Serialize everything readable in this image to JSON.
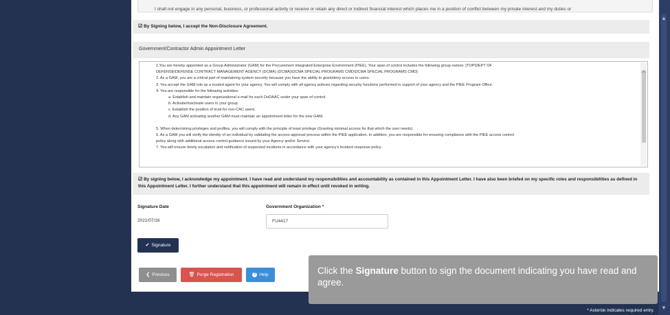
{
  "nda": {
    "last_line": "I shall not engage in any personal, business, or professional activity or receive or retain any direct or indirect financial interest which places me in a position of conflict between my private interest and my duties or",
    "accept_icon": "check-square-icon",
    "accept_text": "By Signing below, I accept the Non-Disclosure Agreement."
  },
  "letter": {
    "heading": "Government/Contractor Admin Appointment Letter",
    "lines": [
      "1.You are hereby appointed as a Group Administrator (GAM) for the Procurement Integrated Enterprise Environment (PIEE). Your span of control includes the following group names: [TOP\\DEPT OF",
      "DEFENSE\\DEFENSE CONTRACT MANAGEMENT AGENCY (DCMA) (DCMA)\\DCMA SPECIAL PROGRAMS CMD\\DCMA SPECIAL PROGRAMS CMD]",
      "2. As a GAM, you are a critical part of maintaining system security because you have the ability to grant/deny access to users.",
      "3. You accept the GAM role as a trusted agent for your agency. You will comply with all agency policies regarding security functions performed in support of your agency and the PIEE Program Office.",
      "4. You are responsible for the following activities:"
    ],
    "sub_items": [
      "a. Establish and maintain organizational e-mail for each DoDAAC under your span of control.",
      "b. Activate/Inactivate users in your group.",
      "c. Establish the position of trust for non-CAC users.",
      "d. Any GAM activating another GAM must maintain an appointment letter for the new GAM."
    ],
    "more_lines": [
      "5. When determining privileges and profiles, you will comply with the principle of least privilege (Granting minimal access for that which the user needs).",
      "6. As a GAM you will verify the identity of an individual by validating the access approval process within the PIEE application. In addition, you are responsible for ensuring compliance with the PIEE access control",
      "policy along with additional access control guidance issued by your Agency and/or Service.",
      "7. You will ensure timely escalation and notification of suspected incidents in accordance with your agency's incident response policy."
    ],
    "ack_text": "By signing below, I acknowledge my appointment. I have read and understand my responsibilities and accountability as contained in this Appointment Letter. I have also been briefed on my specific roles and responsibilities as defined in this Appointment Letter. I further understand that this appointment will remain in effect until revoked in writing."
  },
  "form": {
    "signature_date_label": "Signature Date",
    "signature_date_value": "2021/07/16",
    "gov_org_label": "Government Organization *",
    "gov_org_value": "FU4417"
  },
  "buttons": {
    "signature": "Signature",
    "previous": "Previous",
    "purge": "Purge Registration",
    "help": "Help"
  },
  "tooltip": {
    "prefix": "Click the ",
    "bold": "Signature",
    "suffix": " button to sign the document indicating you have read and agree."
  },
  "footer": {
    "required_note": "* Asterisk indicates required entry."
  }
}
